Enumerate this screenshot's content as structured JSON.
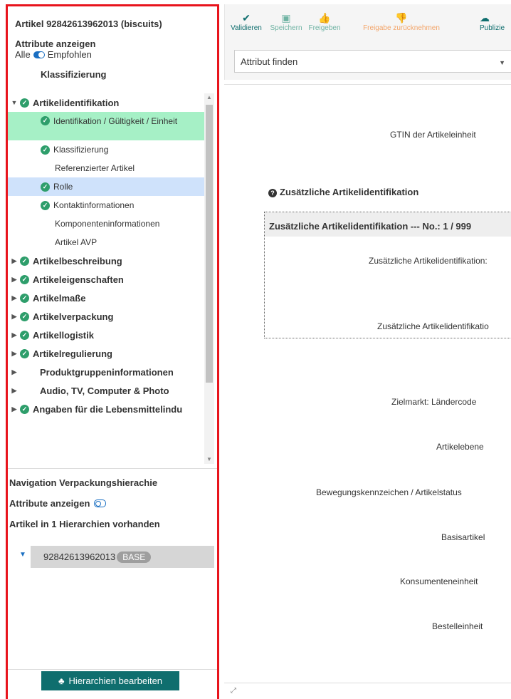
{
  "left": {
    "article_title": "Artikel 92842613962013 (biscuits)",
    "attr_label": "Attribute anzeigen",
    "attr_toggle_left": "Alle",
    "attr_toggle_right": "Empfohlen",
    "klass_heading": "Klassifizierung",
    "tree": {
      "artikelidentifikation": "Artikelidentifikation",
      "children": {
        "identifikation": "Identifikation / Gültigkeit / Einheit",
        "klassifizierung": "Klassifizierung",
        "referenzierter": "Referenzierter Artikel",
        "rolle": "Rolle",
        "kontakt": "Kontaktinformationen",
        "komponenten": "Komponenteninformationen",
        "avp": "Artikel AVP"
      },
      "artikelbeschreibung": "Artikelbeschreibung",
      "artikeleigenschaften": "Artikeleigenschaften",
      "artikelmasse": "Artikelmaße",
      "artikelverpackung": "Artikelverpackung",
      "artikellogistik": "Artikellogistik",
      "artikelregulierung": "Artikelregulierung",
      "produktgruppen": "Produktgruppeninformationen",
      "audio": "Audio, TV, Computer & Photo",
      "lebensmittel": "Angaben für die Lebensmittelindu"
    },
    "nav_heading": "Navigation Verpackungshierachie",
    "nav_attr_label": "Attribute anzeigen",
    "hier_count": "Artikel in 1 Hierarchien vorhanden",
    "hier_gtin": "92842613962013",
    "hier_badge": "BASE",
    "edit_button": "Hierarchien bearbeiten"
  },
  "toolbar": {
    "validate": "Validieren",
    "save": "Speichern",
    "approve": "Freigeben",
    "revoke": "Freigabe zurücknehmen",
    "publish": "Publizie",
    "find_placeholder": "Attribut finden"
  },
  "fields": {
    "gtin": "GTIN der Artikeleinheit",
    "section": "Zusätzliche Artikelidentifikation",
    "repeat_head": "Zusätzliche Artikelidentifikation --- No.: 1 / 999",
    "repeat_f1": "Zusätzliche Artikelidentifikation:",
    "repeat_f2": "Zusätzliche Artikelidentifikatio",
    "zielmarkt": "Zielmarkt: Ländercode",
    "ebene": "Artikelebene",
    "bewegung": "Bewegungskennzeichen / Artikelstatus",
    "basis": "Basisartikel",
    "konsument": "Konsumenteneinheit",
    "bestell": "Bestelleinheit"
  }
}
